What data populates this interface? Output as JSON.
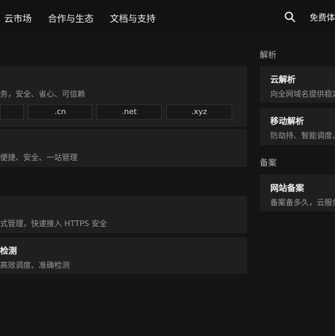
{
  "nav": {
    "items": [
      "云市场",
      "合作与生态",
      "文档与支持"
    ],
    "free_trial": "免费体验"
  },
  "main": {
    "domain_card": {
      "desc": "务，安全、省心、可信赖",
      "suffixes": [
        "",
        ".cn",
        ".net",
        ".xyz"
      ]
    },
    "manage_card": {
      "desc": "便捷、安全、一站管理"
    },
    "ssl_card": {
      "desc": "式管理，快速接入 HTTPS 安全"
    },
    "detect_card": {
      "title": "检测",
      "desc": "高效调度、准确检测"
    }
  },
  "sidebar": {
    "resolve_label": "解析",
    "cloud_resolve": {
      "title": "云解析",
      "desc": "向全网域名提供稳定"
    },
    "mobile_resolve": {
      "title": "移动解析",
      "desc": "防劫持、智能调度、"
    },
    "filing_label": "备案",
    "site_filing": {
      "title": "网站备案",
      "desc": "备案备多久，云服务"
    }
  }
}
